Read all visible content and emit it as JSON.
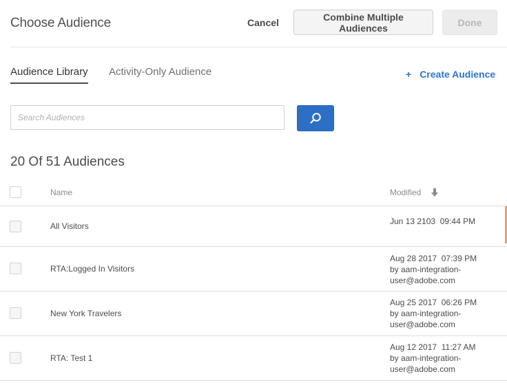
{
  "header": {
    "title": "Choose Audience",
    "cancel_label": "Cancel",
    "combine_label": "Combine Multiple Audiences",
    "done_label": "Done"
  },
  "tabs": [
    {
      "label": "Audience Library",
      "active": true
    },
    {
      "label": "Activity-Only Audience",
      "active": false
    }
  ],
  "create": {
    "icon": "plus-icon",
    "label": "Create Audience"
  },
  "search": {
    "placeholder": "Search Audiences",
    "value": "",
    "button_icon": "search-icon"
  },
  "count_label": "20 Of 51 Audiences",
  "table": {
    "columns": {
      "name": "Name",
      "modified": "Modified",
      "sort_icon": "arrow-down-icon"
    },
    "rows": [
      {
        "name": "All Visitors",
        "date": "Jun 13 2103",
        "time": "09:44 PM",
        "by_line1": "",
        "by_line2": ""
      },
      {
        "name": "RTA:Logged In Visitors",
        "date": "Aug 28 2017",
        "time": "07:39 PM",
        "by_line1": "by aam-integration-",
        "by_line2": "user@adobe.com"
      },
      {
        "name": "New York Travelers",
        "date": "Aug 25 2017",
        "time": "06:26 PM",
        "by_line1": "by aam-integration-",
        "by_line2": "user@adobe.com"
      },
      {
        "name": "RTA: Test 1",
        "date": "Aug 12 2017",
        "time": "11:27 AM",
        "by_line1": "by aam-integration-",
        "by_line2": "user@adobe.com"
      }
    ]
  },
  "colors": {
    "accent": "#2d74c7",
    "search_button": "#2d6fc4",
    "scroll_indicator": "#e8a070"
  }
}
